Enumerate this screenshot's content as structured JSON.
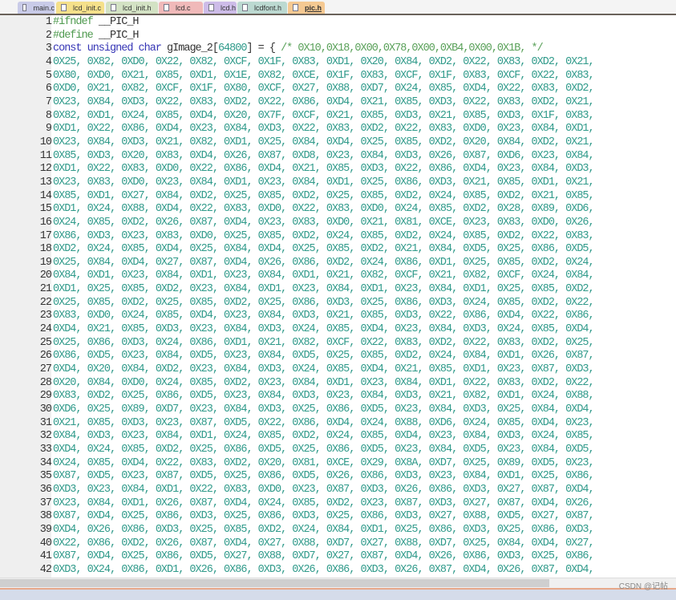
{
  "tabs": [
    {
      "label": "main.c",
      "color": "#c9cbe8",
      "active": false
    },
    {
      "label": "lcd_init.c",
      "color": "#f5e08a",
      "active": false
    },
    {
      "label": "lcd_init.h",
      "color": "#d3e2c4",
      "active": false
    },
    {
      "label": "lcd.c",
      "color": "#f0b9b9",
      "active": false
    },
    {
      "label": "lcd.h",
      "color": "#cdbce8",
      "active": false
    },
    {
      "label": "lcdfont.h",
      "color": "#bcd9d1",
      "active": false
    },
    {
      "label": "pic.h",
      "color": "#f5c992",
      "active": true
    }
  ],
  "header_lines": {
    "l1": {
      "kw": "#ifndef",
      "id": " __PIC_H"
    },
    "l2": {
      "kw": "#define",
      "id": " __PIC_H"
    },
    "l3": {
      "kw": "const unsigned char",
      "id": " gImage_2[",
      "size": "64800",
      "rest": "] = { ",
      "comment": "/* 0X10,0X18,0X00,0X78,0X00,0XB4,0X00,0X1B, */"
    }
  },
  "data_lines": [
    "0X25, 0X82, 0XD0, 0X22, 0X82, 0XCF, 0X1F, 0X83, 0XD1, 0X20, 0X84, 0XD2, 0X22, 0X83, 0XD2, 0X21,",
    "0X80, 0XD0, 0X21, 0X85, 0XD1, 0X1E, 0X82, 0XCE, 0X1F, 0X83, 0XCF, 0X1F, 0X83, 0XCF, 0X22, 0X83,",
    "0XD0, 0X21, 0X82, 0XCF, 0X1F, 0X80, 0XCF, 0X27, 0X88, 0XD7, 0X24, 0X85, 0XD4, 0X22, 0X83, 0XD2,",
    "0X23, 0X84, 0XD3, 0X22, 0X83, 0XD2, 0X22, 0X86, 0XD4, 0X21, 0X85, 0XD3, 0X22, 0X83, 0XD2, 0X21,",
    "0X82, 0XD1, 0X24, 0X85, 0XD4, 0X20, 0X7F, 0XCF, 0X21, 0X85, 0XD3, 0X21, 0X85, 0XD3, 0X1F, 0X83,",
    "0XD1, 0X22, 0X86, 0XD4, 0X23, 0X84, 0XD3, 0X22, 0X83, 0XD2, 0X22, 0X83, 0XD0, 0X23, 0X84, 0XD1,",
    "0X23, 0X84, 0XD3, 0X21, 0X82, 0XD1, 0X25, 0X84, 0XD4, 0X25, 0X85, 0XD2, 0X20, 0X84, 0XD2, 0X21,",
    "0X85, 0XD3, 0X20, 0X83, 0XD4, 0X26, 0X87, 0XD8, 0X23, 0X84, 0XD3, 0X26, 0X87, 0XD6, 0X23, 0X84,",
    "0XD1, 0X22, 0X83, 0XD0, 0X22, 0X86, 0XD4, 0X21, 0X85, 0XD3, 0X22, 0X86, 0XD4, 0X23, 0X84, 0XD3,",
    "0X23, 0X83, 0XD0, 0X23, 0X84, 0XD1, 0X23, 0X84, 0XD1, 0X25, 0X86, 0XD3, 0X21, 0X85, 0XD1, 0X21,",
    "0X85, 0XD1, 0X27, 0X84, 0XD2, 0X25, 0X85, 0XD2, 0X25, 0X85, 0XD2, 0X24, 0X85, 0XD2, 0X21, 0X85,",
    "0XD1, 0X24, 0X88, 0XD4, 0X22, 0X83, 0XD0, 0X22, 0X83, 0XD0, 0X24, 0X85, 0XD2, 0X28, 0X89, 0XD6,",
    "0X24, 0X85, 0XD2, 0X26, 0X87, 0XD4, 0X23, 0X83, 0XD0, 0X21, 0X81, 0XCE, 0X23, 0X83, 0XD0, 0X26,",
    "0X86, 0XD3, 0X23, 0X83, 0XD0, 0X25, 0X85, 0XD2, 0X24, 0X85, 0XD2, 0X24, 0X85, 0XD2, 0X22, 0X83,",
    "0XD2, 0X24, 0X85, 0XD4, 0X25, 0X84, 0XD4, 0X25, 0X85, 0XD2, 0X21, 0X84, 0XD5, 0X25, 0X86, 0XD5,",
    "0X25, 0X84, 0XD4, 0X27, 0X87, 0XD4, 0X26, 0X86, 0XD2, 0X24, 0X86, 0XD1, 0X25, 0X85, 0XD2, 0X24,",
    "0X84, 0XD1, 0X23, 0X84, 0XD1, 0X23, 0X84, 0XD1, 0X21, 0X82, 0XCF, 0X21, 0X82, 0XCF, 0X24, 0X84,",
    "0XD1, 0X25, 0X85, 0XD2, 0X23, 0X84, 0XD1, 0X23, 0X84, 0XD1, 0X23, 0X84, 0XD1, 0X25, 0X85, 0XD2,",
    "0X25, 0X85, 0XD2, 0X25, 0X85, 0XD2, 0X25, 0X86, 0XD3, 0X25, 0X86, 0XD3, 0X24, 0X85, 0XD2, 0X22,",
    "0X83, 0XD0, 0X24, 0X85, 0XD4, 0X23, 0X84, 0XD3, 0X21, 0X85, 0XD3, 0X22, 0X86, 0XD4, 0X22, 0X86,",
    "0XD4, 0X21, 0X85, 0XD3, 0X23, 0X84, 0XD3, 0X24, 0X85, 0XD4, 0X23, 0X84, 0XD3, 0X24, 0X85, 0XD4,",
    "0X25, 0X86, 0XD3, 0X24, 0X86, 0XD1, 0X21, 0X82, 0XCF, 0X22, 0X83, 0XD2, 0X22, 0X83, 0XD2, 0X25,",
    "0X86, 0XD5, 0X23, 0X84, 0XD5, 0X23, 0X84, 0XD5, 0X25, 0X85, 0XD2, 0X24, 0X84, 0XD1, 0X26, 0X87,",
    "0XD4, 0X20, 0X84, 0XD2, 0X23, 0X84, 0XD3, 0X24, 0X85, 0XD4, 0X21, 0X85, 0XD1, 0X23, 0X87, 0XD3,",
    "0X20, 0X84, 0XD0, 0X24, 0X85, 0XD2, 0X23, 0X84, 0XD1, 0X23, 0X84, 0XD1, 0X22, 0X83, 0XD2, 0X22,",
    "0X83, 0XD2, 0X25, 0X86, 0XD5, 0X23, 0X84, 0XD3, 0X23, 0X84, 0XD3, 0X21, 0X82, 0XD1, 0X24, 0X88,",
    "0XD6, 0X25, 0X89, 0XD7, 0X23, 0X84, 0XD3, 0X25, 0X86, 0XD5, 0X23, 0X84, 0XD3, 0X25, 0X84, 0XD4,",
    "0X21, 0X85, 0XD3, 0X23, 0X87, 0XD5, 0X22, 0X86, 0XD4, 0X24, 0X88, 0XD6, 0X24, 0X85, 0XD4, 0X23,",
    "0X84, 0XD3, 0X23, 0X84, 0XD1, 0X24, 0X85, 0XD2, 0X24, 0X85, 0XD4, 0X23, 0X84, 0XD3, 0X24, 0X85,",
    "0XD4, 0X24, 0X85, 0XD2, 0X25, 0X86, 0XD5, 0X25, 0X86, 0XD5, 0X23, 0X84, 0XD5, 0X23, 0X84, 0XD5,",
    "0X24, 0X85, 0XD4, 0X22, 0X83, 0XD2, 0X20, 0X81, 0XCE, 0X29, 0X8A, 0XD7, 0X25, 0X89, 0XD5, 0X23,",
    "0X87, 0XD5, 0X23, 0X87, 0XD5, 0X25, 0X86, 0XD5, 0X26, 0X86, 0XD3, 0X23, 0X84, 0XD1, 0X25, 0X86,",
    "0XD3, 0X23, 0X84, 0XD1, 0X22, 0X83, 0XD0, 0X23, 0X87, 0XD3, 0X26, 0X86, 0XD3, 0X27, 0X87, 0XD4,",
    "0X23, 0X84, 0XD1, 0X26, 0X87, 0XD4, 0X24, 0X85, 0XD2, 0X23, 0X87, 0XD3, 0X27, 0X87, 0XD4, 0X26,",
    "0X87, 0XD4, 0X25, 0X86, 0XD3, 0X25, 0X86, 0XD3, 0X25, 0X86, 0XD3, 0X27, 0X88, 0XD5, 0X27, 0X87,",
    "0XD4, 0X26, 0X86, 0XD3, 0X25, 0X85, 0XD2, 0X24, 0X84, 0XD1, 0X25, 0X86, 0XD3, 0X25, 0X86, 0XD3,",
    "0X22, 0X86, 0XD2, 0X26, 0X87, 0XD4, 0X27, 0X88, 0XD7, 0X27, 0X88, 0XD7, 0X25, 0X84, 0XD4, 0X27,",
    "0X87, 0XD4, 0X25, 0X86, 0XD5, 0X27, 0X88, 0XD7, 0X27, 0X87, 0XD4, 0X26, 0X86, 0XD3, 0X25, 0X86,",
    "0XD3, 0X24, 0X86, 0XD1, 0X26, 0X86, 0XD3, 0X26, 0X86, 0XD3, 0X26, 0X87, 0XD4, 0X26, 0X87, 0XD4,"
  ],
  "watermark": "CSDN @记帖",
  "colors": {
    "number": "#2f9a8a",
    "keyword": "#3535b5",
    "preprocessor": "#4f9a4f",
    "comment": "#58a058"
  }
}
